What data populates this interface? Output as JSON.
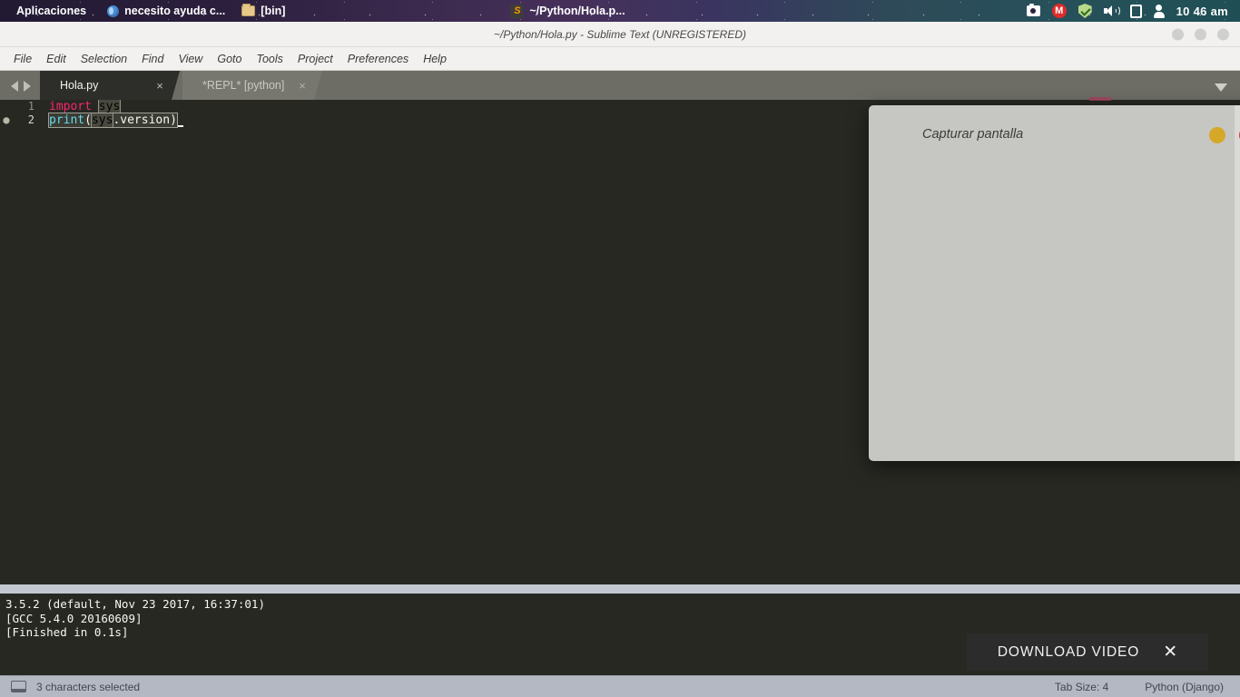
{
  "topbar": {
    "apps_label": "Aplicaciones",
    "window_items": [
      {
        "icon": "globe-icon",
        "label": "necesito ayuda c..."
      },
      {
        "icon": "folder-icon",
        "label": "[bin]"
      }
    ],
    "focused_window": {
      "icon": "sublime-icon",
      "label": "~/Python/Hola.p..."
    },
    "tray_icons": [
      "camera-icon",
      "gmail-icon",
      "shield-icon",
      "volume-icon",
      "battery-icon",
      "user-icon"
    ],
    "clock": "10 46 am"
  },
  "window": {
    "title": "~/Python/Hola.py - Sublime Text (UNREGISTERED)",
    "controls": [
      "minimize-button",
      "maximize-button",
      "close-button"
    ]
  },
  "menu": {
    "items": [
      "File",
      "Edit",
      "Selection",
      "Find",
      "View",
      "Goto",
      "Tools",
      "Project",
      "Preferences",
      "Help"
    ]
  },
  "tabs": {
    "nav_prev": "◀",
    "nav_next": "▶",
    "items": [
      {
        "label": "Hola.py",
        "active": true,
        "close": "×"
      },
      {
        "label": "*REPL* [python]",
        "active": false,
        "close": "×"
      }
    ],
    "menu_glyph": "▼"
  },
  "editor": {
    "lines": [
      {
        "number": "1",
        "modified": "",
        "tokens": [
          {
            "text": "import",
            "style": "kw"
          },
          {
            "text": " ",
            "style": "pl"
          },
          {
            "text": "sys",
            "style": "hl"
          }
        ]
      },
      {
        "number": "2",
        "modified": "●",
        "tokens": [
          {
            "text": "print",
            "style": "fn"
          },
          {
            "text": "(",
            "style": "pl"
          },
          {
            "text": "sys",
            "style": "hl"
          },
          {
            "text": ".version",
            "style": "pl"
          },
          {
            "text": ")",
            "style": "pl"
          }
        ]
      }
    ],
    "line1_code": "import sys",
    "line2_code": "print(sys.version)"
  },
  "output": {
    "lines": [
      "3.5.2 (default, Nov 23 2017, 16:37:01)",
      "[GCC 5.4.0 20160609]",
      "[Finished in 0.1s]"
    ]
  },
  "status": {
    "icon": "console-icon",
    "selection": "3 characters selected",
    "tab_size": "Tab Size: 4",
    "syntax": "Python (Django)"
  },
  "dialog": {
    "title": "Capturar pantalla",
    "dot_yellow": "record-indicator",
    "dot_red": "stop-indicator"
  },
  "banner": {
    "label": "DOWNLOAD VIDEO",
    "close": "✕"
  },
  "colors": {
    "editor_bg": "#272822",
    "keyword": "#f92672",
    "function": "#66d9ef",
    "plain": "#f8f8f2",
    "tabbar": "#6d6d66",
    "statusbar": "#b3b8c2",
    "dialog_bg": "#c6c6c2",
    "accent_yellow": "#d6a82a",
    "accent_red": "#cf3b3b"
  }
}
